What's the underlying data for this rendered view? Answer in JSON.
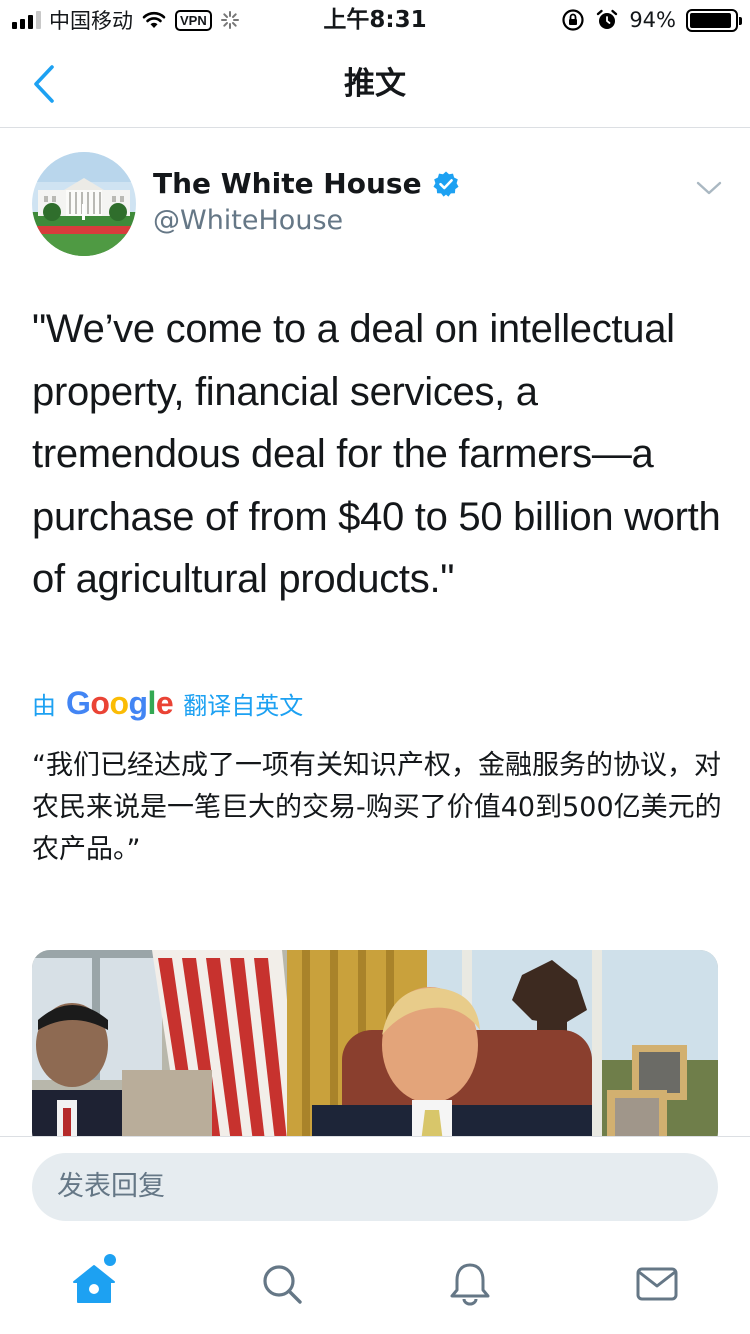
{
  "status_bar": {
    "carrier": "中国移动",
    "vpn_label": "VPN",
    "time": "上午8:31",
    "battery_text": "94%",
    "battery_level": 0.94
  },
  "nav": {
    "title": "推文"
  },
  "tweet": {
    "author_name": "The White House",
    "author_handle": "@WhiteHouse",
    "verified": true,
    "text": "\"We’ve come to a deal on intellectual property, financial services, a tremendous deal for the farmers—a purchase of from $40 to 50 billion worth of agricultural products.\"",
    "translate_prefix": "由",
    "translate_provider": "Google",
    "translate_suffix": "翻译自英文",
    "translated_text": "“我们已经达成了一项有关知识产权，金融服务的协议，对农民来说是一笔巨大的交易-购买了价值40到500亿美元的农产品。”"
  },
  "reply": {
    "placeholder": "发表回复"
  },
  "tabs": [
    {
      "icon": "home-icon",
      "active": true
    },
    {
      "icon": "search-icon",
      "active": false
    },
    {
      "icon": "bell-icon",
      "active": false
    },
    {
      "icon": "mail-icon",
      "active": false
    }
  ],
  "colors": {
    "accent": "#1da1f2",
    "text": "#14171a",
    "secondary": "#657786",
    "divider": "#dcdfe3",
    "input_bg": "#e6ecf0"
  }
}
